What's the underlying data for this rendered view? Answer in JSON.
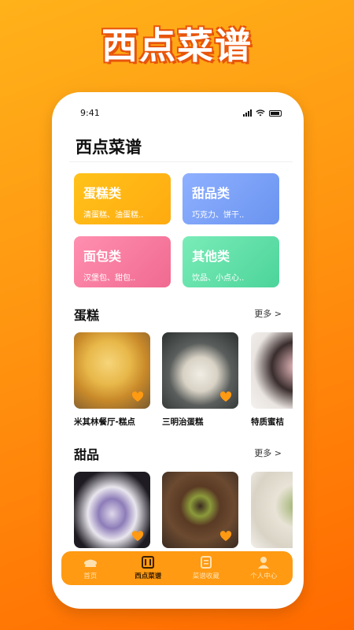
{
  "promo_title": "西点菜谱",
  "status": {
    "time": "9:41"
  },
  "page_title": "西点菜谱",
  "categories": [
    {
      "name": "蛋糕类",
      "subtitle": "清蛋糕、油蛋糕..",
      "color": "#ffb415"
    },
    {
      "name": "甜品类",
      "subtitle": "巧克力、饼干..",
      "color": "#7aa2f7"
    },
    {
      "name": "面包类",
      "subtitle": "汉堡包、甜包..",
      "color": "#f77ca0"
    },
    {
      "name": "其他类",
      "subtitle": "饮品、小点心..",
      "color": "#5fe0aa"
    }
  ],
  "sections": {
    "cake": {
      "title": "蛋糕",
      "more": "更多 >",
      "items": [
        {
          "name": "米其林餐厅-糕点"
        },
        {
          "name": "三明治蛋糕"
        },
        {
          "name": "特质蜜桔"
        }
      ]
    },
    "dessert": {
      "title": "甜品",
      "more": "更多 >",
      "items": [
        {
          "name": ""
        },
        {
          "name": ""
        },
        {
          "name": ""
        }
      ]
    }
  },
  "tabs": [
    {
      "label": "首页",
      "icon": "home-icon",
      "active": false
    },
    {
      "label": "西点菜谱",
      "icon": "recipe-book-icon",
      "active": true
    },
    {
      "label": "菜谱收藏",
      "icon": "favorites-icon",
      "active": false
    },
    {
      "label": "个人中心",
      "icon": "user-icon",
      "active": false
    }
  ],
  "colors": {
    "accent": "#ff9a12",
    "heart": "#ff9a12"
  }
}
